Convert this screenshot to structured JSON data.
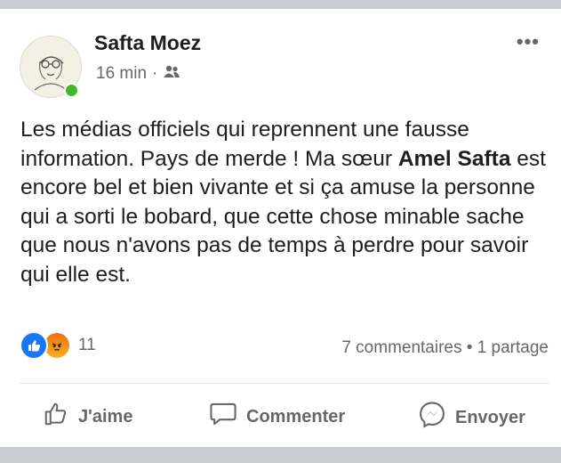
{
  "post": {
    "author": "Safta Moez",
    "time": "16 min",
    "separator": "·",
    "more": "•••",
    "text_part1": "Les médias officiels qui reprennent une fausse information. Pays de merde ! Ma sœur ",
    "text_bold": "Amel Safta",
    "text_part2": " est encore bel et bien vivante et si ça amuse la personne qui a sorti le bobard, que cette chose minable sache que nous n'avons pas de temps à perdre pour savoir qui elle est."
  },
  "reactions": {
    "count": "11",
    "icons": [
      "like-icon",
      "angry-icon"
    ]
  },
  "stats": {
    "text": "7 commentaires • 1 partage"
  },
  "actions": {
    "like": "J'aime",
    "comment": "Commenter",
    "send": "Envoyer"
  }
}
